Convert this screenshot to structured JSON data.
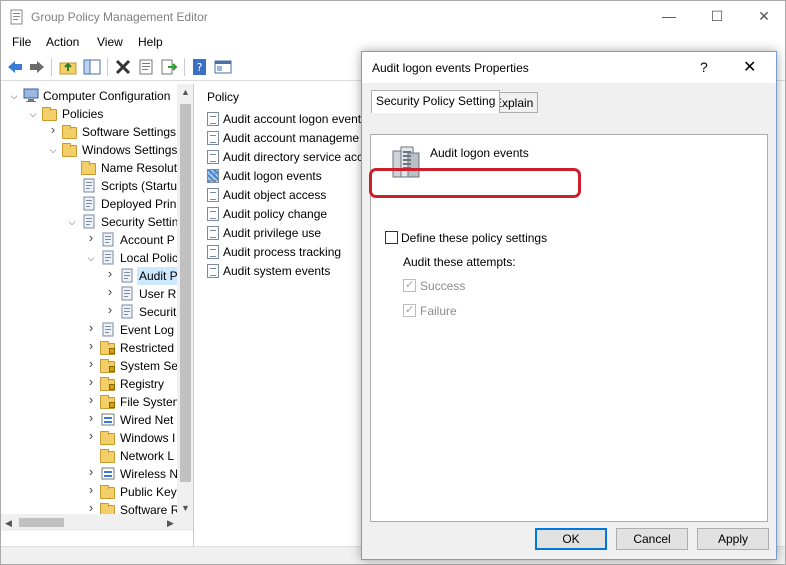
{
  "window": {
    "title": "Group Policy Management Editor",
    "controls": {
      "minimize": "—",
      "maximize": "☐",
      "close": "✕"
    }
  },
  "menu": [
    "File",
    "Action",
    "View",
    "Help"
  ],
  "toolbar": [
    "back-icon",
    "forward-icon",
    "folder-up-icon",
    "show-hide-tree-icon",
    "delete-icon",
    "properties-icon",
    "export-icon",
    "help-icon",
    "console-icon"
  ],
  "tree": [
    {
      "label": "Computer Configuration",
      "expander": "open",
      "icon": "computer-icon"
    },
    {
      "label": "Policies",
      "expander": "open",
      "icon": "folder-icon"
    },
    {
      "label": "Software Settings",
      "expander": "closed",
      "icon": "folder-icon"
    },
    {
      "label": "Windows Settings",
      "expander": "open",
      "icon": "folder-icon"
    },
    {
      "label": "Name Resolut",
      "expander": "",
      "icon": "folder-icon"
    },
    {
      "label": "Scripts (Startu",
      "expander": "",
      "icon": "script-icon"
    },
    {
      "label": "Deployed Prin",
      "expander": "",
      "icon": "printer-icon"
    },
    {
      "label": "Security Settin",
      "expander": "open",
      "icon": "security-icon"
    },
    {
      "label": "Account P",
      "expander": "closed",
      "icon": "policy-icon"
    },
    {
      "label": "Local Polic",
      "expander": "open",
      "icon": "policy-icon"
    },
    {
      "label": "Audit P",
      "expander": "closed",
      "icon": "policy-icon",
      "selected": true
    },
    {
      "label": "User Ri",
      "expander": "closed",
      "icon": "policy-icon"
    },
    {
      "label": "Securit",
      "expander": "closed",
      "icon": "policy-icon"
    },
    {
      "label": "Event Log",
      "expander": "closed",
      "icon": "policy-icon"
    },
    {
      "label": "Restricted",
      "expander": "closed",
      "icon": "folder-lock-icon"
    },
    {
      "label": "System Se",
      "expander": "closed",
      "icon": "folder-lock-icon"
    },
    {
      "label": "Registry",
      "expander": "closed",
      "icon": "folder-lock-icon"
    },
    {
      "label": "File System",
      "expander": "closed",
      "icon": "folder-lock-icon"
    },
    {
      "label": "Wired Net",
      "expander": "closed",
      "icon": "network-icon"
    },
    {
      "label": "Windows I",
      "expander": "closed",
      "icon": "folder-icon"
    },
    {
      "label": "Network L",
      "expander": "",
      "icon": "folder-icon"
    },
    {
      "label": "Wireless N",
      "expander": "closed",
      "icon": "network-icon"
    },
    {
      "label": "Public Key",
      "expander": "closed",
      "icon": "folder-icon"
    },
    {
      "label": "Software R",
      "expander": "closed",
      "icon": "folder-icon"
    }
  ],
  "list": {
    "header": "Policy",
    "items": [
      {
        "label": "Audit account logon event"
      },
      {
        "label": "Audit account manageme"
      },
      {
        "label": "Audit directory service acc"
      },
      {
        "label": "Audit logon events",
        "selected": true
      },
      {
        "label": "Audit object access"
      },
      {
        "label": "Audit policy change"
      },
      {
        "label": "Audit privilege use"
      },
      {
        "label": "Audit process tracking"
      },
      {
        "label": "Audit system events"
      }
    ]
  },
  "dialog": {
    "title": "Audit logon events Properties",
    "help": "?",
    "close": "✕",
    "tabs": [
      "Security Policy Setting",
      "Explain"
    ],
    "policy_name": "Audit logon events",
    "define_label": "Define these policy settings",
    "define_checked": false,
    "attempts_label": "Audit these attempts:",
    "success_label": "Success",
    "failure_label": "Failure",
    "buttons": {
      "ok": "OK",
      "cancel": "Cancel",
      "apply": "Apply"
    }
  },
  "colors": {
    "highlight": "#cc1f2b",
    "selection": "#cce8ff",
    "accent": "#0078d7"
  }
}
